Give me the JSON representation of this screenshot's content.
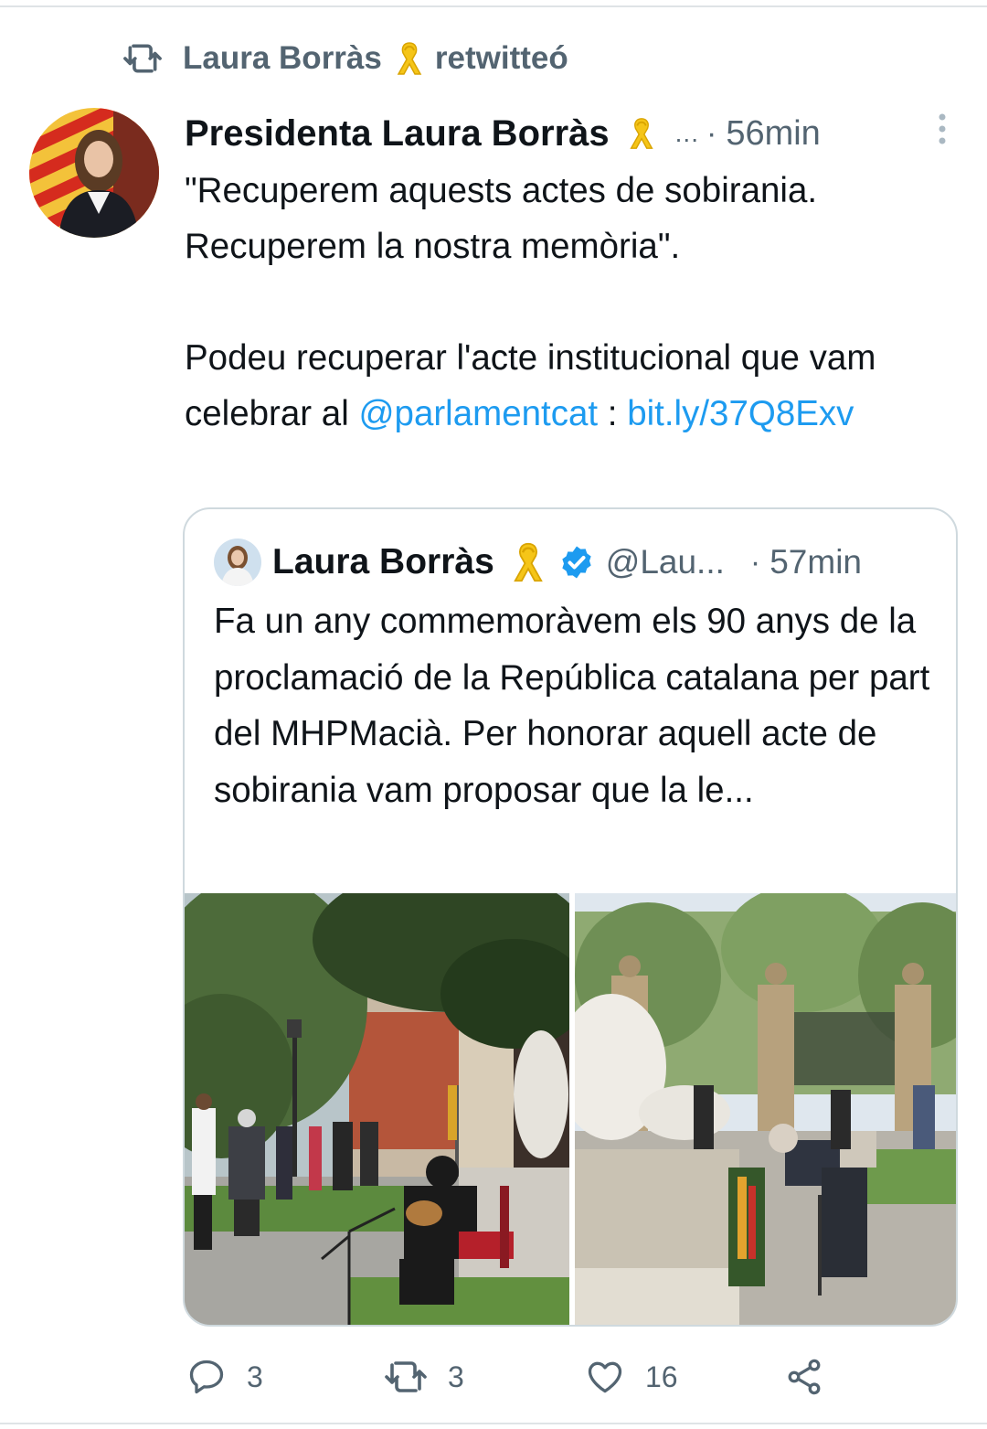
{
  "retweet": {
    "icon": "retweet-icon",
    "user": "Laura Borràs",
    "ribbon": "yellow-ribbon-icon",
    "action": "retwitteó"
  },
  "tweet": {
    "display_name": "Presidenta Laura Borràs",
    "handle_truncated": "...",
    "separator": "·",
    "time": "56min",
    "text_part1": "\"Recuperem aquests actes de sobirania. Recuperem la nostra memòria\".\n\nPodeu recuperar l'acte institucional que vam celebrar al ",
    "mention": "@parlamentcat",
    "text_part2": " : ",
    "link": "bit.ly/37Q8Exv"
  },
  "quoted": {
    "display_name": "Laura Borràs",
    "handle": "@Lau...",
    "separator": "·",
    "time": "57min",
    "text": "Fa un any commemoràvem els 90 anys de la proclamació de la República catalana per part del MHPMacià. Per honorar aquell acte de sobirania vam proposar que la le..."
  },
  "actions": {
    "reply_count": "3",
    "retweet_count": "3",
    "like_count": "16"
  },
  "colors": {
    "link": "#1d9bf0",
    "secondary_text": "#536471",
    "verified": "#1d9bf0",
    "ribbon": "#f5c518"
  }
}
